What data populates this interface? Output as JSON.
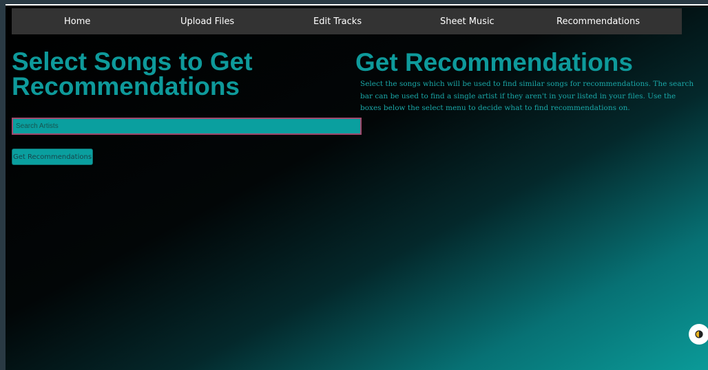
{
  "nav": {
    "items": [
      {
        "label": "Home"
      },
      {
        "label": "Upload Files"
      },
      {
        "label": "Edit Tracks"
      },
      {
        "label": "Sheet Music"
      },
      {
        "label": "Recommendations"
      }
    ]
  },
  "select_panel": {
    "title": "Select Songs to Get Recommendations",
    "search": {
      "placeholder": "Search Artists",
      "value": ""
    },
    "button_label": "Get Recommendations"
  },
  "info_panel": {
    "title": "Get Recommendations",
    "description": "Select the songs which will be used to find similar songs for recommendations. The search bar can be used to find a single artist if they aren't in your listed in your files. Use the boxes below the select menu to decide what to find recommendations on."
  },
  "theme_toggle": {
    "icon": "contrast-icon"
  },
  "colors": {
    "accent": "#0e9a9b",
    "navbar": "#333333",
    "input_border": "#a14a6e",
    "button": "#0a9f9f"
  }
}
